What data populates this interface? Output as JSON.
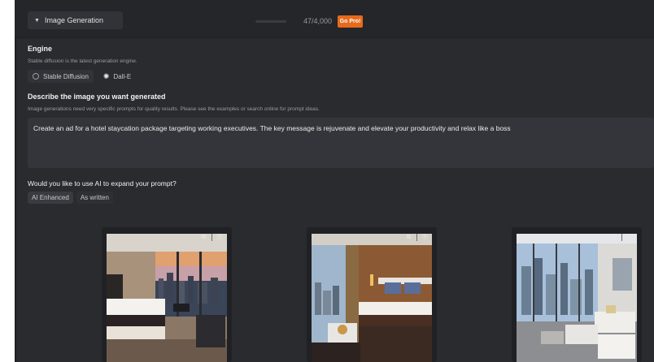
{
  "section": {
    "title": "Image Generation"
  },
  "credits": {
    "usage": "47/4,000",
    "go_pro_label": "Go Pro!"
  },
  "engine": {
    "title": "Engine",
    "description": "Stable diffusion is the latest generation engine.",
    "options": [
      {
        "label": "Stable Diffusion",
        "icon": "radio-icon"
      },
      {
        "label": "Dall-E",
        "icon": "openai-icon"
      }
    ]
  },
  "prompt": {
    "title": "Describe the image you want generated",
    "description": "Image generations need very specific prompts for quality results. Please see the examples or search online for prompt ideas.",
    "value": "Create an ad for a hotel staycation package targeting working executives. The key message is  rejuvenate and elevate your productivity and relax like a boss"
  },
  "expand": {
    "question": "Would you like to use AI to expand your prompt?",
    "options": [
      "AI Enhanced",
      "As written"
    ],
    "selected": "AI Enhanced"
  },
  "images": [
    {
      "tools": [
        "copy-icon",
        "download-icon"
      ]
    },
    {
      "tools": [
        "copy-icon",
        "download-icon"
      ]
    },
    {
      "tools": [
        "copy-icon",
        "download-icon"
      ]
    }
  ]
}
